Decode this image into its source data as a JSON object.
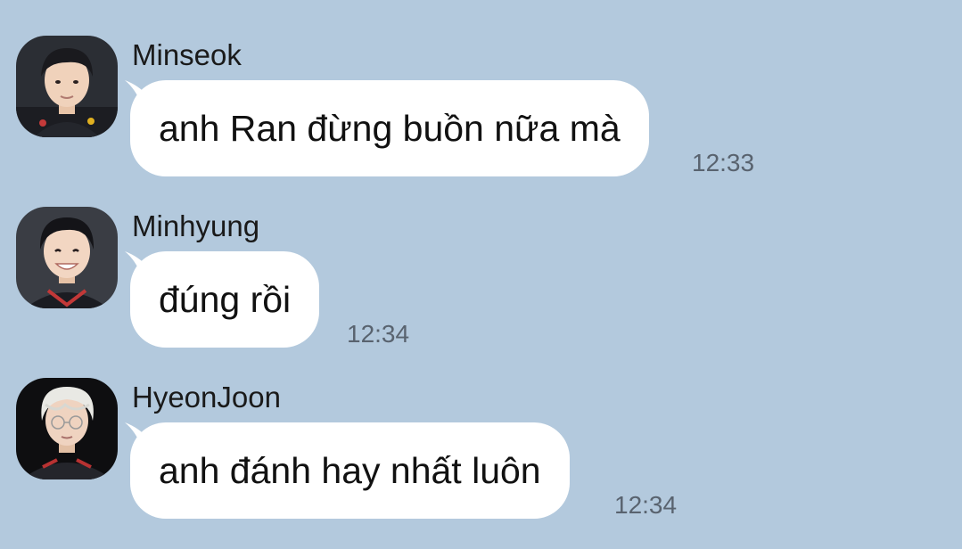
{
  "colors": {
    "background": "#b3c9dd",
    "bubble": "#ffffff",
    "timestamp": "#59636f"
  },
  "messages": [
    {
      "sender": "Minseok",
      "text": "anh Ran đừng buồn nữa mà",
      "time": "12:33",
      "avatar": "avatar-icon"
    },
    {
      "sender": "Minhyung",
      "text": "đúng rồi",
      "time": "12:34",
      "avatar": "avatar-icon"
    },
    {
      "sender": "HyeonJoon",
      "text": "anh đánh hay nhất luôn",
      "time": "12:34",
      "avatar": "avatar-icon"
    }
  ]
}
